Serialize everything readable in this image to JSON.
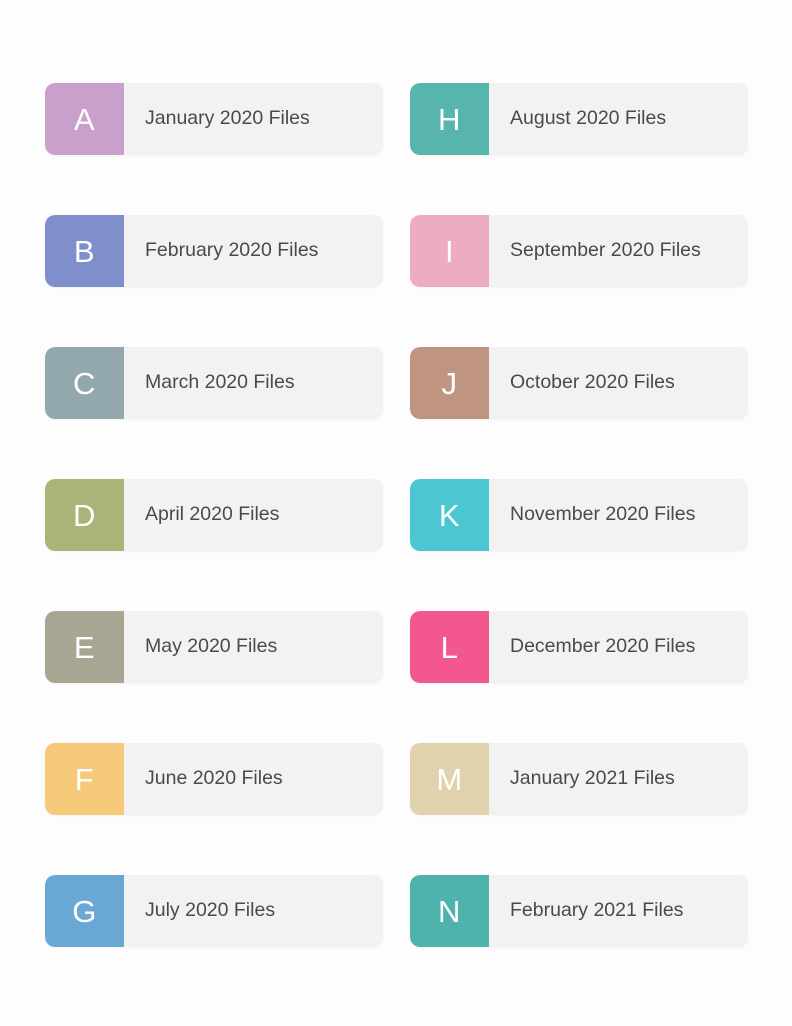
{
  "page": {
    "background_color": "#fdfdfd",
    "card_background_color": "#f2f2f2",
    "card_text_color": "#4a4a4a",
    "letter_text_color": "#ffffff"
  },
  "labels": [
    {
      "letter": "A",
      "title": "January 2020 Files",
      "color": "#c9a0cb",
      "column": "left"
    },
    {
      "letter": "B",
      "title": "February 2020 Files",
      "color": "#7f8fcc",
      "column": "left"
    },
    {
      "letter": "C",
      "title": "March 2020 Files",
      "color": "#93a8ad",
      "column": "left"
    },
    {
      "letter": "D",
      "title": "April 2020 Files",
      "color": "#a9b577",
      "column": "left"
    },
    {
      "letter": "E",
      "title": "May 2020 Files",
      "color": "#a8a593",
      "column": "left"
    },
    {
      "letter": "F",
      "title": "June 2020 Files",
      "color": "#f6c87a",
      "column": "left"
    },
    {
      "letter": "G",
      "title": "July 2020 Files",
      "color": "#69a8d4",
      "column": "left"
    },
    {
      "letter": "H",
      "title": "August 2020 Files",
      "color": "#58b5ae",
      "column": "right"
    },
    {
      "letter": "I",
      "title": "September 2020 Files",
      "color": "#eeabc4",
      "column": "right"
    },
    {
      "letter": "J",
      "title": "October 2020 Files",
      "color": "#bf9582",
      "column": "right"
    },
    {
      "letter": "K",
      "title": "November 2020 Files",
      "color": "#4cc6d2",
      "column": "right"
    },
    {
      "letter": "L",
      "title": "December 2020 Files",
      "color": "#f2578f",
      "column": "right"
    },
    {
      "letter": "M",
      "title": "January 2021 Files",
      "color": "#e0d2ac",
      "column": "right"
    },
    {
      "letter": "N",
      "title": "February 2021 Files",
      "color": "#4fb2ad",
      "column": "right"
    }
  ]
}
